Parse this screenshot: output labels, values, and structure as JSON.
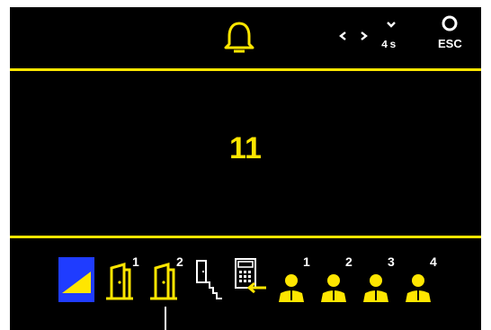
{
  "header": {
    "alarm_icon": "bell-icon",
    "nav_left_icon": "chevron-left-icon",
    "nav_right_icon": "chevron-right-icon",
    "nav_down_icon": "chevron-down-icon",
    "hold_label": "4s",
    "esc_label": "ESC"
  },
  "main": {
    "value": "11"
  },
  "icons": [
    {
      "name": "level-icon",
      "selected": true
    },
    {
      "name": "door-1-icon",
      "superscript": "1"
    },
    {
      "name": "door-2-icon",
      "superscript": "2"
    },
    {
      "name": "stairs-exit-icon"
    },
    {
      "name": "keypad-entry-icon"
    },
    {
      "name": "user-1-icon",
      "superscript": "1"
    },
    {
      "name": "user-2-icon",
      "superscript": "2"
    },
    {
      "name": "user-3-icon",
      "superscript": "3"
    },
    {
      "name": "user-4-icon",
      "superscript": "4"
    }
  ],
  "colors": {
    "accent": "#ffe600",
    "selected_background": "#1f3cff",
    "background": "#000000",
    "text": "#ffffff"
  }
}
